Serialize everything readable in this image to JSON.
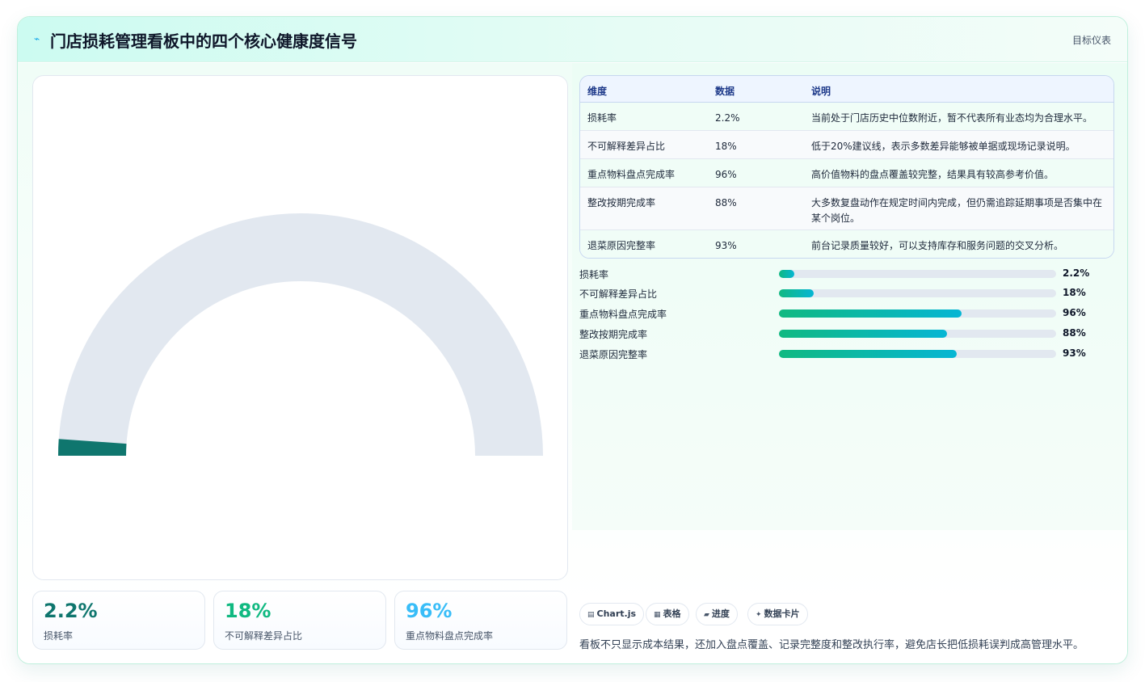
{
  "header": {
    "icon": "pulse-icon",
    "icon_glyph": "⌁",
    "title": "门店损耗管理看板中的四个核心健康度信号",
    "tag": "目标仪表"
  },
  "gauge": {
    "value": 2.2,
    "max": 100,
    "fill_color": "#0f766e",
    "track_color": "#e2e8f0"
  },
  "kpis": [
    {
      "value": "2.2%",
      "label": "损耗率",
      "color": "#0f766e"
    },
    {
      "value": "18%",
      "label": "不可解释差异占比",
      "color": "#10b981"
    },
    {
      "value": "96%",
      "label": "重点物料盘点完成率",
      "color": "#38bdf8"
    }
  ],
  "table": {
    "headers": [
      "维度",
      "数据",
      "说明"
    ],
    "rows": [
      {
        "dim": "损耗率",
        "value": "2.2%",
        "note": "当前处于门店历史中位数附近，暂不代表所有业态均为合理水平。"
      },
      {
        "dim": "不可解释差异占比",
        "value": "18%",
        "note": "低于20%建议线，表示多数差异能够被单据或现场记录说明。"
      },
      {
        "dim": "重点物料盘点完成率",
        "value": "96%",
        "note": "高价值物料的盘点覆盖较完整，结果具有较高参考价值。"
      },
      {
        "dim": "整改按期完成率",
        "value": "88%",
        "note": "大多数复盘动作在规定时间内完成，但仍需追踪延期事项是否集中在某个岗位。"
      },
      {
        "dim": "退菜原因完整率",
        "value": "93%",
        "note": "前台记录质量较好，可以支持库存和服务问题的交叉分析。"
      }
    ]
  },
  "bars": [
    {
      "label": "损耗率",
      "value": "2.2%",
      "fill": 0.055
    },
    {
      "label": "不可解释差异占比",
      "value": "18%",
      "fill": 0.125
    },
    {
      "label": "重点物料盘点完成率",
      "value": "96%",
      "fill": 0.66
    },
    {
      "label": "整改按期完成率",
      "value": "88%",
      "fill": 0.605
    },
    {
      "label": "退菜原因完整率",
      "value": "93%",
      "fill": 0.64
    }
  ],
  "chips": [
    {
      "icon": "chart-icon",
      "glyph": "▤",
      "label": "Chart.js"
    },
    {
      "icon": "table-icon",
      "glyph": "▦",
      "label": "表格"
    },
    {
      "icon": "progress-icon",
      "glyph": "▰",
      "label": "进度"
    },
    {
      "icon": "sparkle-icon",
      "glyph": "✦",
      "label": "数据卡片"
    }
  ],
  "footer_note": "看板不只显示成本结果，还加入盘点覆盖、记录完整度和整改执行率，避免店长把低损耗误判成高管理水平。"
}
